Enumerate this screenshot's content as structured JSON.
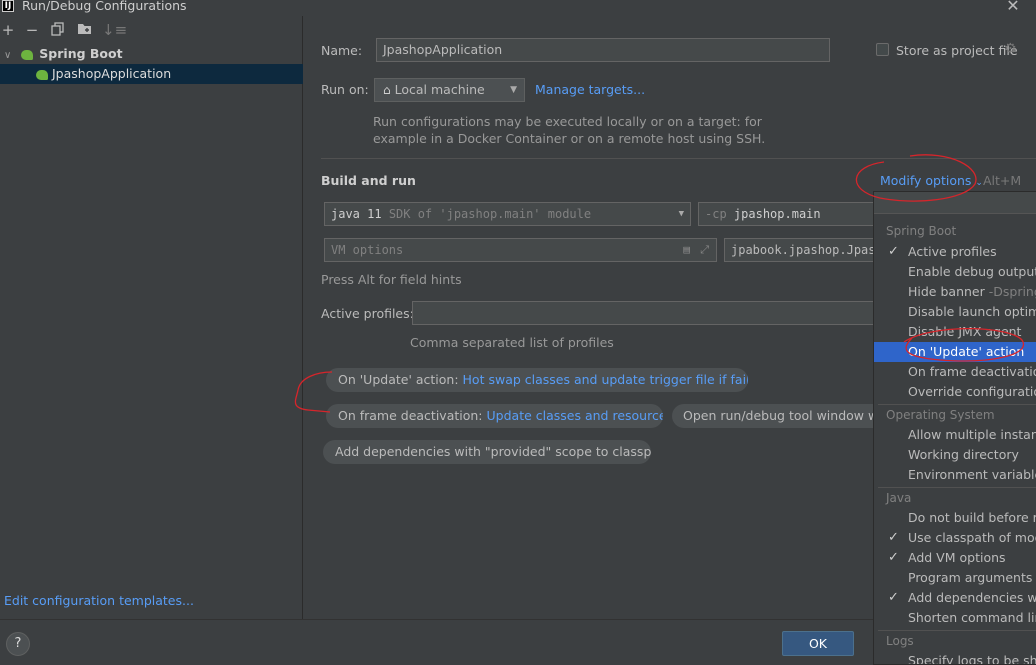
{
  "window": {
    "title": "Run/Debug Configurations",
    "app_icon": "IJ"
  },
  "left": {
    "toolbar": [
      "add-icon",
      "remove-icon",
      "copy-icon",
      "new-folder-icon",
      "sort-icon"
    ],
    "tree": {
      "group": "Spring Boot",
      "selected_item": "JpashopApplication"
    },
    "edit_templates": "Edit configuration templates..."
  },
  "form": {
    "name_label": "Name:",
    "name_value": "JpashopApplication",
    "store_label": "Store as project file",
    "run_on_label": "Run on:",
    "run_on_value": "Local machine",
    "manage_targets": "Manage targets...",
    "run_on_hint_1": "Run configurations may be executed locally or on a target: for",
    "run_on_hint_2": "example in a Docker Container or on a remote host using SSH.",
    "build_run": "Build and run",
    "modify_options": "Modify options",
    "modify_shortcut": "Alt+M",
    "sdk_java": "java 11",
    "sdk_rest": "SDK of 'jpashop.main' module",
    "cp_flag": "-cp",
    "cp_value": "jpashop.main",
    "vm_placeholder": "VM options",
    "main_class": "jpabook.jpashop.Jpash",
    "alt_hint": "Press Alt for field hints",
    "active_profiles_label": "Active profiles:",
    "active_profiles_value": "",
    "profiles_hint": "Comma separated list of profiles"
  },
  "chips": {
    "update_label": "On 'Update' action:",
    "update_value": "Hot swap classes and update trigger file if failed",
    "frame_label": "On frame deactivation:",
    "frame_value": "Update classes and resources",
    "open_tool": "Open run/debug tool window wher",
    "provided_deps": "Add dependencies with \"provided\" scope to classpath"
  },
  "popup": {
    "spring_boot_header": "Spring Boot",
    "spring_items": [
      {
        "label": "Active profiles",
        "checked": true
      },
      {
        "label": "Enable debug output",
        "extra": "-"
      },
      {
        "label": "Hide banner",
        "extra": "-Dspring.r"
      },
      {
        "label": "Disable launch optimiza"
      },
      {
        "label": "Disable JMX agent"
      },
      {
        "label": "On 'Update' action",
        "selected": true
      },
      {
        "label": "On frame deactivation"
      },
      {
        "label": "Override configuration p"
      }
    ],
    "os_header": "Operating System",
    "os_items": [
      "Allow multiple instances",
      "Working directory",
      "Environment variables"
    ],
    "java_header": "Java",
    "java_items": [
      {
        "label": "Do not build before run"
      },
      {
        "label": "Use classpath of module",
        "checked": true
      },
      {
        "label": "Add VM options",
        "checked": true
      },
      {
        "label": "Program arguments"
      },
      {
        "label": "Add dependencies with",
        "checked": true
      },
      {
        "label": "Shorten command line"
      }
    ],
    "logs_header": "Logs",
    "logs_items": [
      "Specify logs to be show"
    ]
  },
  "footer": {
    "help": "?",
    "ok": "OK"
  },
  "colors": {
    "accent": "#589df6",
    "selection": "#2f65ca",
    "annotation": "#d6252b"
  }
}
